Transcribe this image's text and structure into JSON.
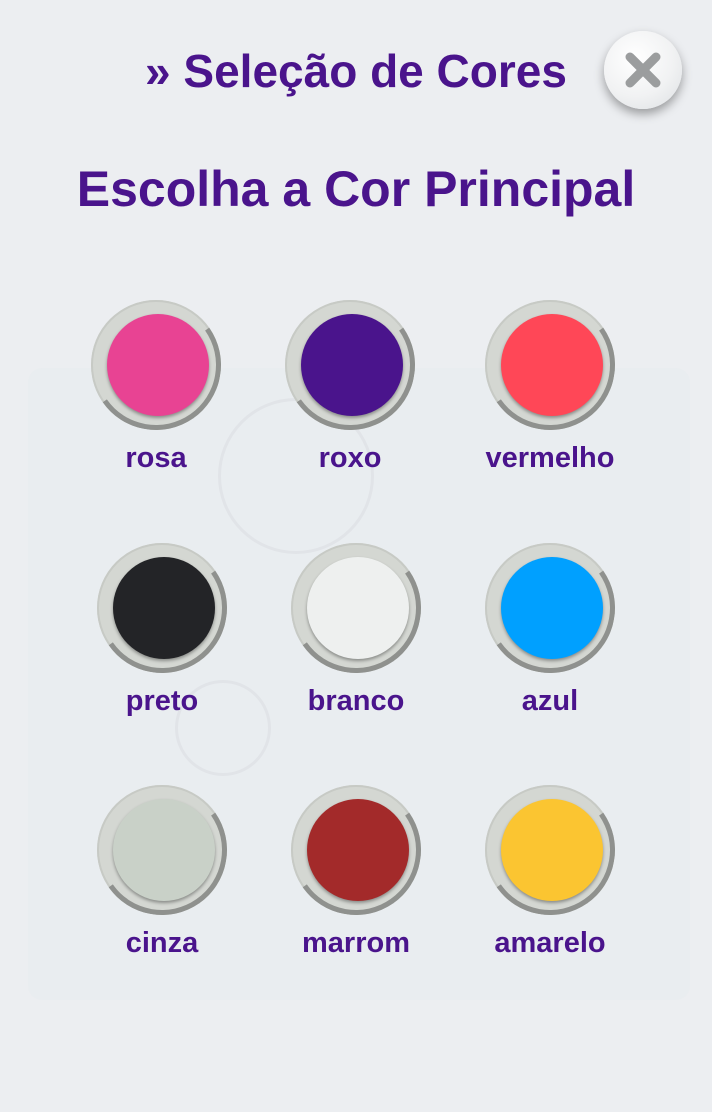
{
  "header": {
    "title": "» Seleção de Cores",
    "close_icon": "close-icon"
  },
  "main": {
    "subtitle": "Escolha a Cor Principal"
  },
  "colors": [
    {
      "label": "rosa",
      "hex": "#e84393"
    },
    {
      "label": "roxo",
      "hex": "#4a148c"
    },
    {
      "label": "vermelho",
      "hex": "#ff4757"
    },
    {
      "label": "preto",
      "hex": "#232427"
    },
    {
      "label": "branco",
      "hex": "#eef0ef"
    },
    {
      "label": "azul",
      "hex": "#00a0ff"
    },
    {
      "label": "cinza",
      "hex": "#c9d1c8"
    },
    {
      "label": "marrom",
      "hex": "#a32a2a"
    },
    {
      "label": "amarelo",
      "hex": "#fbc531"
    }
  ],
  "theme": {
    "accent": "#4a148c",
    "background": "#eceef1"
  }
}
